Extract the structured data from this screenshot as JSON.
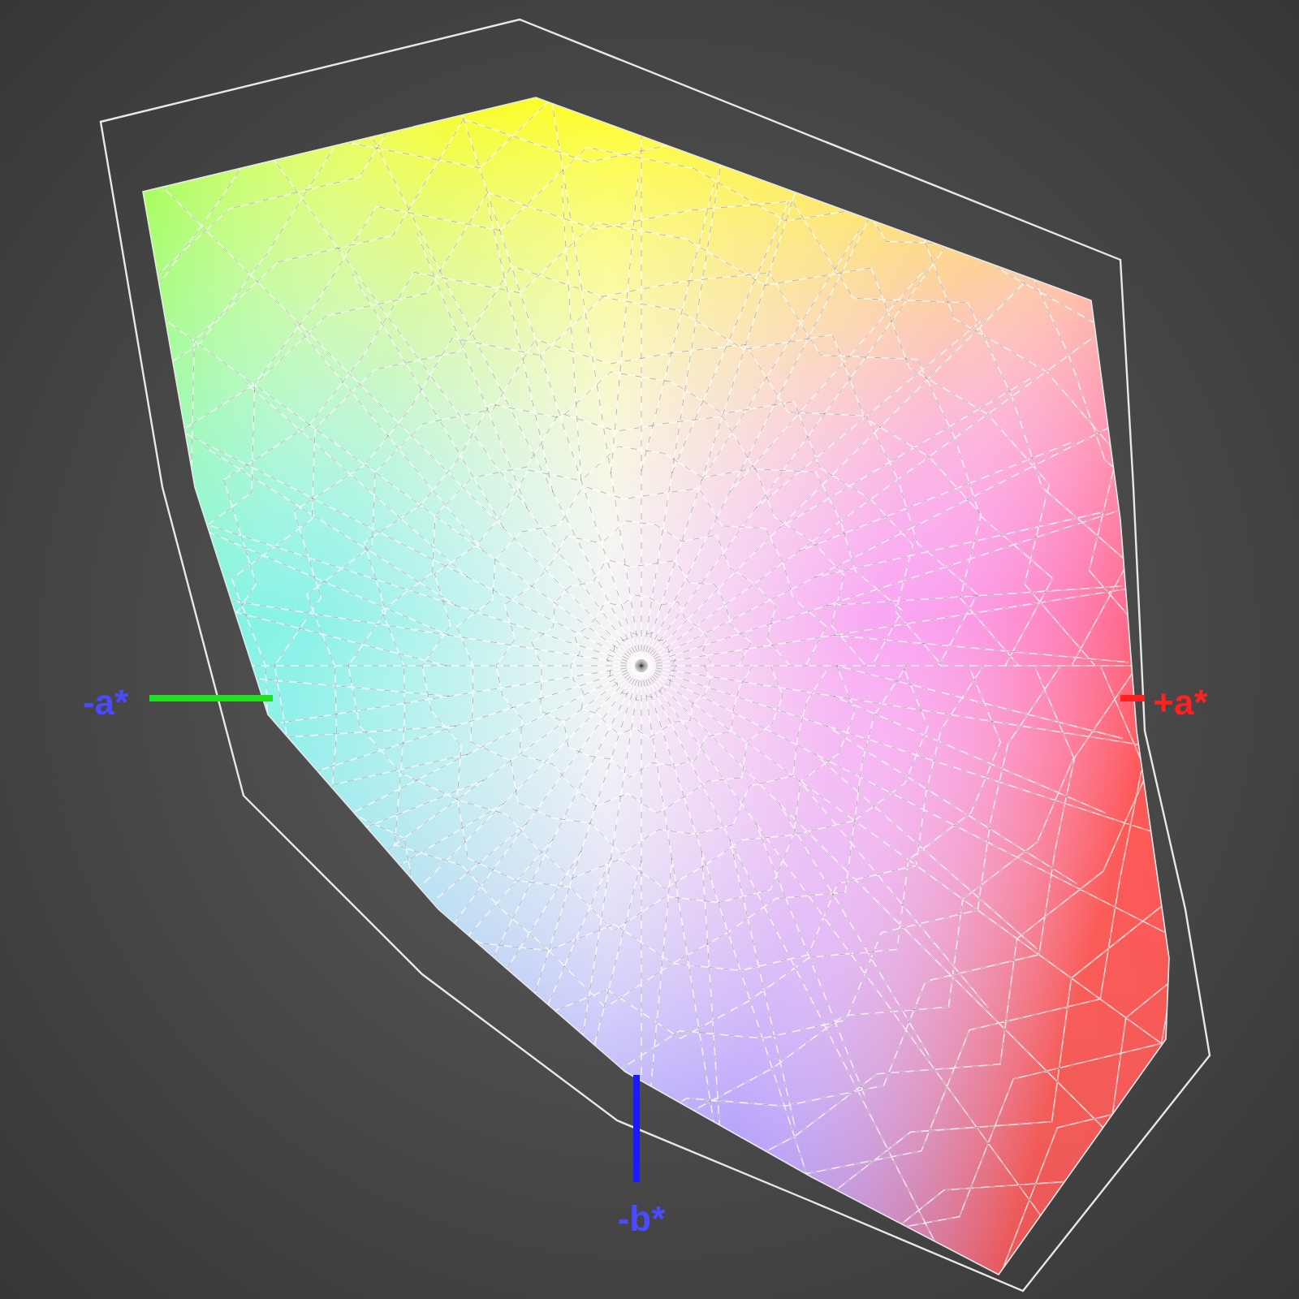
{
  "axes": [
    {
      "label": "-a*",
      "color": "#22dd22"
    },
    {
      "label": "+a*",
      "color": "#ff2020"
    },
    {
      "label": "-b*",
      "color": "#1a1aff"
    }
  ]
}
